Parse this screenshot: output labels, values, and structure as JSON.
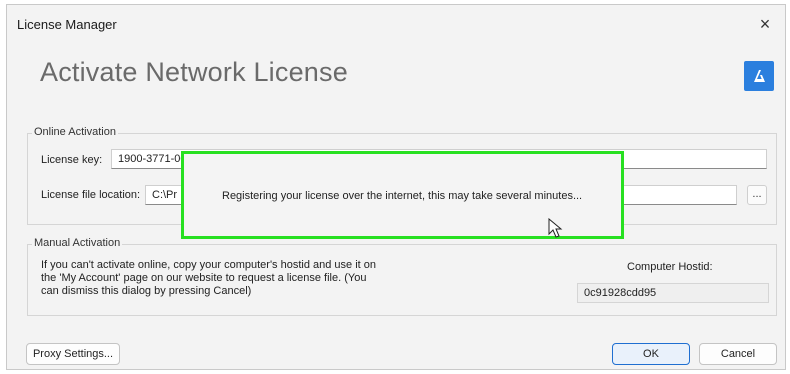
{
  "window": {
    "title": "License Manager",
    "close_glyph": "×"
  },
  "page": {
    "heading": "Activate Network License",
    "logo_icon": "bricscad-logo-icon",
    "logo_color": "#2b7fde"
  },
  "online": {
    "legend": "Online Activation",
    "license_key_label": "License key:",
    "license_key_value": "1900-3771-00",
    "license_file_label": "License file location:",
    "license_file_value": "C:\\Pr",
    "browse_label": "..."
  },
  "overlay": {
    "message": "Registering your license over the internet, this may take several minutes...",
    "border_color": "#27e020"
  },
  "manual": {
    "legend": "Manual Activation",
    "description": "If you can't activate online, copy your computer's hostid and use it on the 'My Account' page on our website to request a license file. (You can dismiss this dialog by pressing Cancel)",
    "hostid_label": "Computer Hostid:",
    "hostid_value": "0c91928cdd95"
  },
  "buttons": {
    "proxy": "Proxy Settings...",
    "ok": "OK",
    "cancel": "Cancel"
  }
}
